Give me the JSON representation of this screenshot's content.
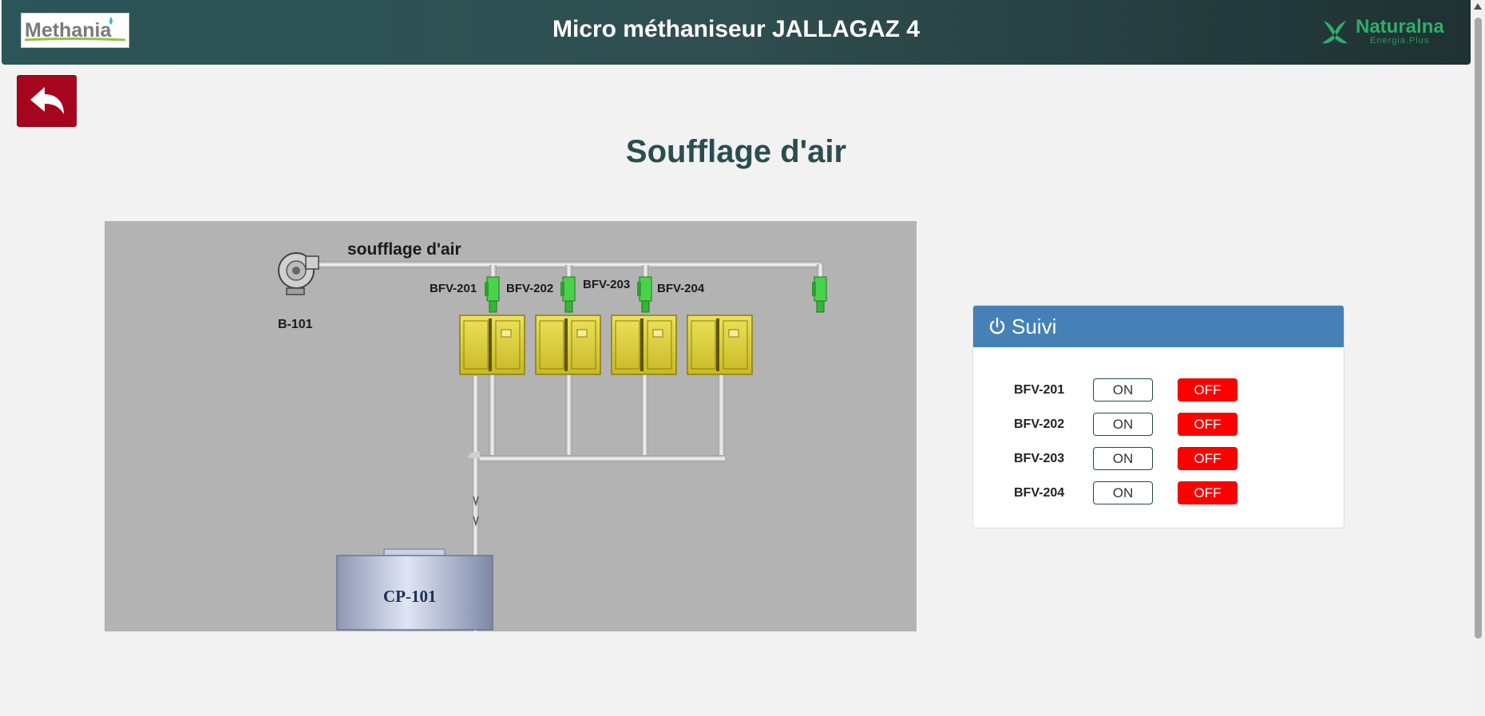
{
  "header": {
    "title": "Micro méthaniseur JALLAGAZ 4",
    "logo_left": "Methania",
    "logo_right": "Naturalna",
    "logo_right_sub": "Energia.Plus",
    "gradient_left": "#2b5558",
    "gradient_right": "#1f3132"
  },
  "nav": {
    "back_icon": "reply-arrow-icon"
  },
  "page": {
    "title": "Soufflage d'air"
  },
  "diagram": {
    "pipe_label": "soufflage d'air",
    "blower_label": "B-101",
    "tank_label": "CP-101",
    "valves": [
      "BFV-201",
      "BFV-202",
      "BFV-203",
      "BFV-204"
    ]
  },
  "suivi": {
    "title": "Suivi",
    "icon": "power-icon",
    "rows": [
      {
        "label": "BFV-201",
        "on": "ON",
        "off": "OFF"
      },
      {
        "label": "BFV-202",
        "on": "ON",
        "off": "OFF"
      },
      {
        "label": "BFV-203",
        "on": "ON",
        "off": "OFF"
      },
      {
        "label": "BFV-204",
        "on": "ON",
        "off": "OFF"
      }
    ]
  },
  "colors": {
    "back_button": "#a5061d",
    "panel_header": "#4581b6",
    "off_button": "#ff0000",
    "title": "#2a4d50"
  }
}
